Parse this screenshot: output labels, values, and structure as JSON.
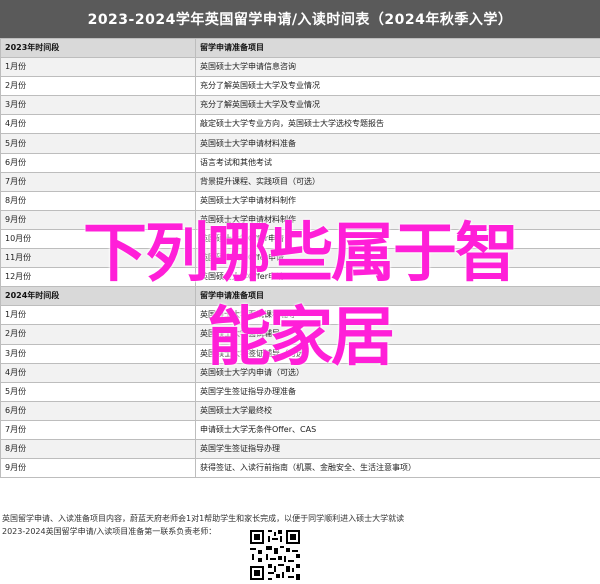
{
  "title": "2023-2024学年英国留学申请/入读时间表（2024年秋季入学）",
  "table": {
    "header_period": "2023年时间段",
    "header_items": "留学申请准备项目",
    "rows_2023": [
      [
        "1月份",
        "英国硕士大学申请信息咨询"
      ],
      [
        "2月份",
        "充分了解英国硕士大学及专业情况"
      ],
      [
        "3月份",
        "充分了解英国硕士大学及专业情况"
      ],
      [
        "4月份",
        "敲定硕士大学专业方向，英国硕士大学选校专题报告"
      ],
      [
        "5月份",
        "英国硕士大学申请材料准备"
      ],
      [
        "6月份",
        "语言考试和其他考试"
      ],
      [
        "7月份",
        "背景提升课程、实践项目（可选）"
      ],
      [
        "8月份",
        "英国硕士大学申请材料制作"
      ],
      [
        "9月份",
        "英国硕士大学申请材料制作"
      ],
      [
        "10月份",
        "英国硕士大学Offer申请"
      ],
      [
        "11月份",
        "英国硕士大学Offer申请"
      ],
      [
        "12月份",
        "英国硕士大学Offer申请"
      ]
    ],
    "header_period_2024": "2024年时间段",
    "rows_2024": [
      [
        "1月份",
        "英国硕士大学面试课程辅导"
      ],
      [
        "2月份",
        "英国硕士大学面试辅导"
      ],
      [
        "3月份",
        "英国硕士大学签证辅导（可选）"
      ],
      [
        "4月份",
        "英国硕士大学内申请（可选）"
      ],
      [
        "5月份",
        "英国学生签证指导办理准备"
      ],
      [
        "6月份",
        "英国硕士大学最终校"
      ],
      [
        "7月份",
        "申请硕士大学无条件Offer、CAS"
      ],
      [
        "8月份",
        "英国学生签证指导办理"
      ],
      [
        "9月份",
        "获得签证、入读行前指南（机票、金融安全、生活注意事项）"
      ]
    ]
  },
  "footer": {
    "line1": "英国留学申请、入读准备项目内容，蔚蓝天府老师会1对1帮助学生和家长完成，以便于同学顺利进入硕士大学就读",
    "line2": "2023-2024英国留学申请/入读项目准备第一联系负责老师："
  },
  "overlay": {
    "line1": "下列哪些属于智",
    "line2": "能家居"
  },
  "colors": {
    "title_bg": "#5a5a5a",
    "header_bg": "#d9d9d9",
    "overlay": "#ff1fd8"
  }
}
